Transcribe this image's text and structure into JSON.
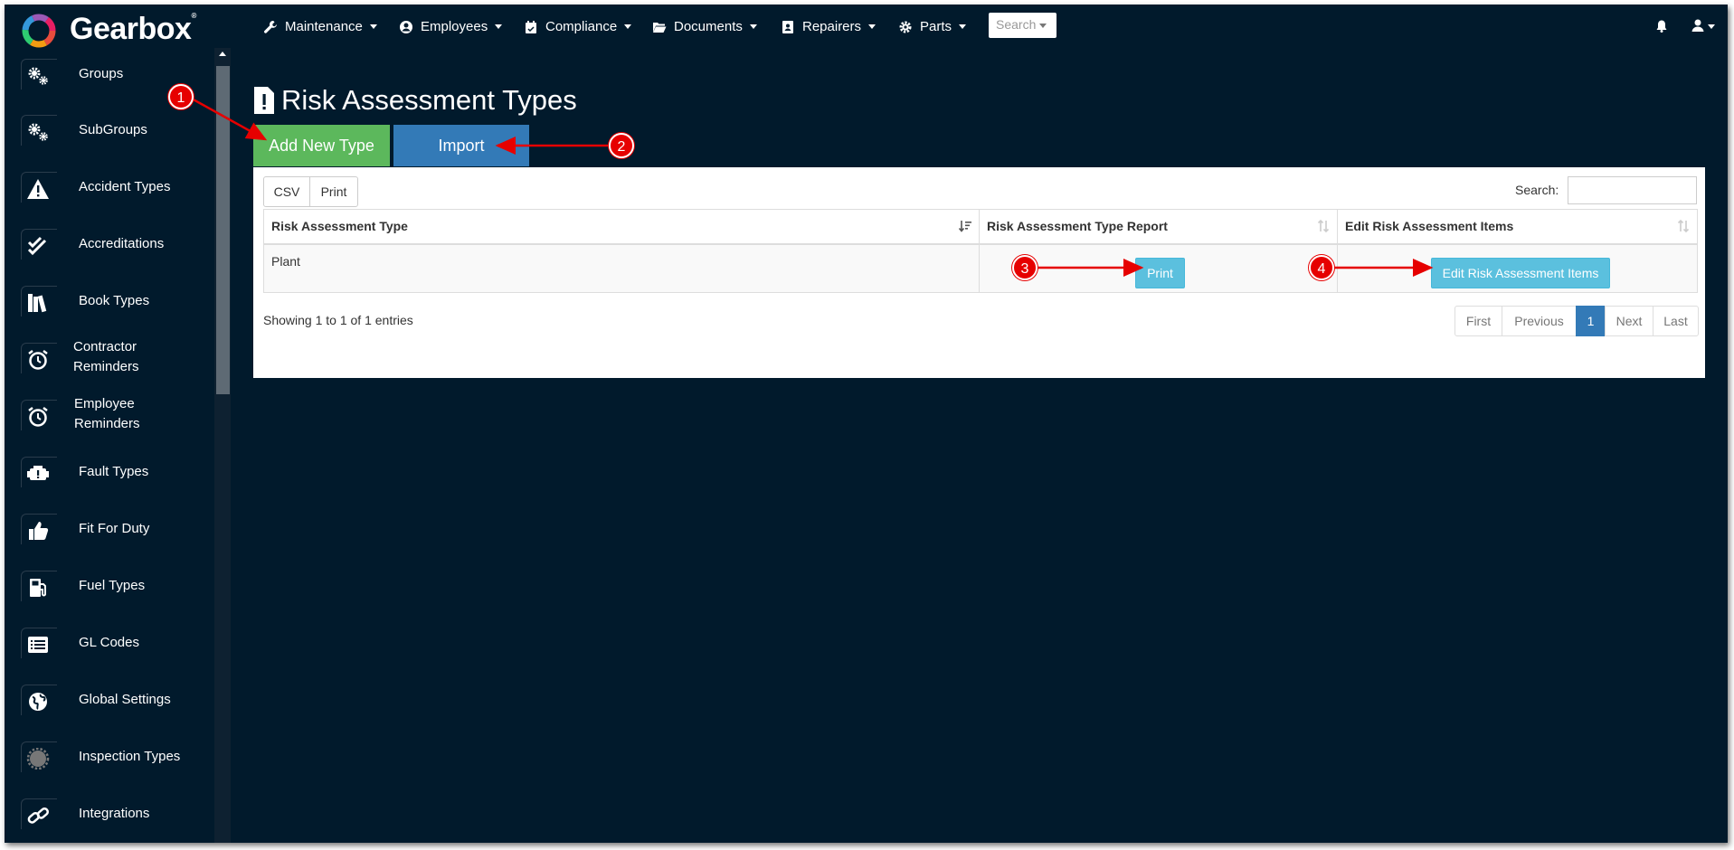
{
  "brand": {
    "name": "Gearbox",
    "mark": "®"
  },
  "nav": [
    {
      "label": "Maintenance",
      "icon": "wrench-icon"
    },
    {
      "label": "Employees",
      "icon": "user-circle-icon"
    },
    {
      "label": "Compliance",
      "icon": "calendar-check-icon"
    },
    {
      "label": "Documents",
      "icon": "folder-open-icon"
    },
    {
      "label": "Repairers",
      "icon": "address-book-icon"
    },
    {
      "label": "Parts",
      "icon": "cog-icon"
    }
  ],
  "search_dropdown": {
    "placeholder": "Search"
  },
  "sidebar": {
    "items": [
      {
        "label": "Groups",
        "icon": "cogs-icon"
      },
      {
        "label": "SubGroups",
        "icon": "cogs-icon"
      },
      {
        "label": "Accident Types",
        "icon": "warning-icon"
      },
      {
        "label": "Accreditations",
        "icon": "check-icon"
      },
      {
        "label": "Book Types",
        "icon": "books-icon"
      },
      {
        "label": "Contractor Reminders",
        "line1": "Contractor",
        "line2": "Reminders",
        "icon": "alarm-clock-icon"
      },
      {
        "label": "Employee Reminders",
        "line1": "Employee",
        "line2": "Reminders",
        "icon": "alarm-clock-icon"
      },
      {
        "label": "Fault Types",
        "icon": "engine-warning-icon"
      },
      {
        "label": "Fit For Duty",
        "icon": "thumbs-up-icon"
      },
      {
        "label": "Fuel Types",
        "icon": "gas-pump-icon"
      },
      {
        "label": "GL Codes",
        "icon": "list-alt-icon"
      },
      {
        "label": "Global Settings",
        "icon": "globe-icon"
      },
      {
        "label": "Inspection Types",
        "icon": "certificate-icon"
      },
      {
        "label": "Integrations",
        "icon": "link-icon"
      }
    ]
  },
  "page": {
    "title": "Risk Assessment Types",
    "add_button": "Add New Type",
    "import_button": "Import"
  },
  "table_tools": {
    "csv": "CSV",
    "print": "Print",
    "search_label": "Search:",
    "search_value": ""
  },
  "table": {
    "columns": [
      "Risk Assessment Type",
      "Risk Assessment Type Report",
      "Edit Risk Assessment Items"
    ],
    "rows": [
      {
        "type": "Plant",
        "report_button": "Print",
        "edit_button": "Edit Risk Assessment Items"
      }
    ]
  },
  "footer": {
    "info": "Showing 1 to 1 of 1 entries",
    "pagination": {
      "first": "First",
      "previous": "Previous",
      "current": "1",
      "next": "Next",
      "last": "Last"
    }
  },
  "annotations": [
    "1",
    "2",
    "3",
    "4"
  ],
  "colors": {
    "background": "#011a2c",
    "success": "#5cb85c",
    "primary": "#337ab7",
    "info": "#5bc0de",
    "annotation": "#e60000"
  }
}
